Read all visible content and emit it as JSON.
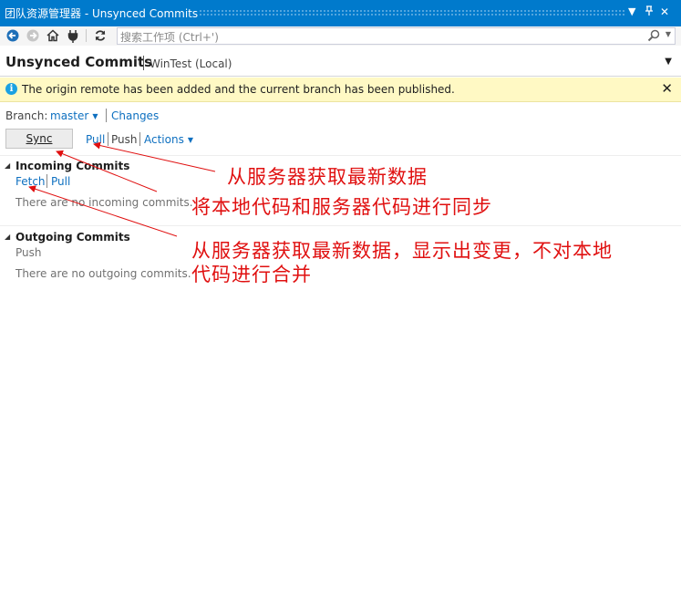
{
  "window": {
    "title": "团队资源管理器 - Unsynced Commits",
    "controls": [
      "▾",
      "⊥",
      "✕"
    ]
  },
  "toolbar": {
    "search_placeholder": "搜索工作项 (Ctrl+')"
  },
  "header": {
    "title": "Unsynced Commits",
    "subtitle": "WinTest (Local)"
  },
  "info": {
    "message": "The origin remote has been added and the current branch has been published."
  },
  "branch": {
    "label": "Branch:",
    "value": "master",
    "changes_link": "Changes"
  },
  "actions": {
    "sync": "Sync",
    "pull": "Pull",
    "push": "Push",
    "actions": "Actions"
  },
  "incoming": {
    "title": "Incoming Commits",
    "fetch": "Fetch",
    "pull": "Pull",
    "empty": "There are no incoming commits."
  },
  "outgoing": {
    "title": "Outgoing Commits",
    "push": "Push",
    "empty": "There are no outgoing commits."
  },
  "annotations": {
    "pull_note": "从服务器获取最新数据",
    "sync_note": "将本地代码和服务器代码进行同步",
    "fetch_note_line1": "从服务器获取最新数据，显示出变更，不对本地",
    "fetch_note_line2": "代码进行合并"
  },
  "colors": {
    "titlebar": "#007acc",
    "link": "#0e70c0",
    "infobar": "#fff9c4",
    "annotation": "#e01010"
  }
}
